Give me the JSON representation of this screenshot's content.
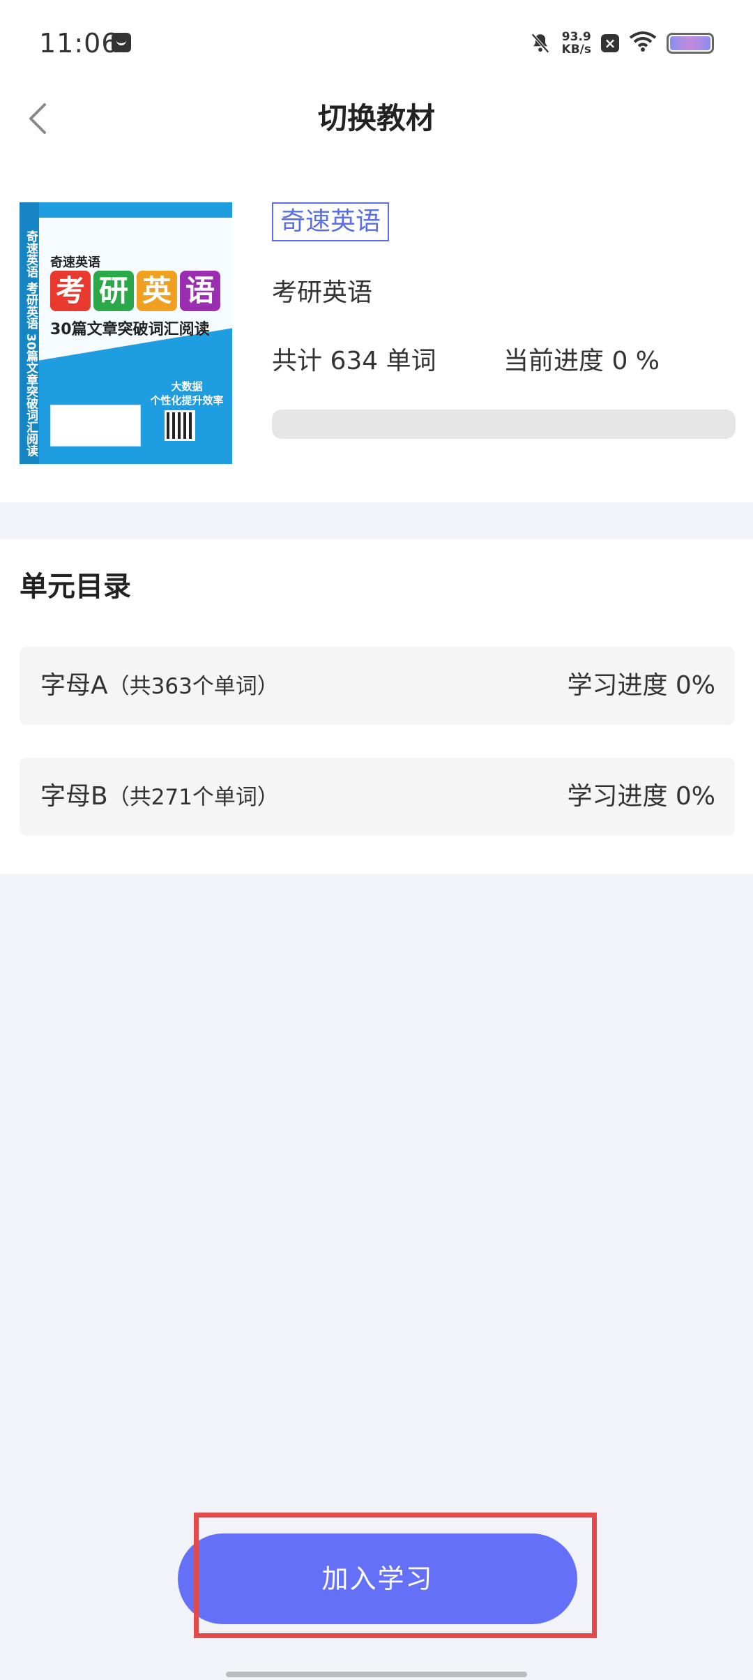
{
  "status_bar": {
    "time": "11:06",
    "net_speed_value": "93.9",
    "net_speed_unit": "KB/s",
    "battery_level": 1.0
  },
  "header": {
    "title": "切换教材"
  },
  "book": {
    "tag": "奇速英语",
    "name": "考研英语",
    "total": "共计 634 单词",
    "progress_text": "当前进度 0 %",
    "progress_value": 0,
    "cover": {
      "brand": "奇速英语",
      "spine": "奇速英语 考研英语 30篇文章突破词汇阅读",
      "tiles": [
        "考",
        "研",
        "英",
        "语"
      ],
      "tile_colors": [
        "#e8392f",
        "#2aa84a",
        "#f0a020",
        "#9a2db0"
      ],
      "subtitle": "30篇文章突破词汇阅读",
      "badge_line1": "大数据",
      "badge_line2": "个性化提升效率"
    }
  },
  "units": {
    "title": "单元目录",
    "items": [
      {
        "name": "字母A",
        "count": "（共363个单词）",
        "progress": "学习进度 0%"
      },
      {
        "name": "字母B",
        "count": "（共271个单词）",
        "progress": "学习进度 0%"
      }
    ]
  },
  "footer": {
    "join_label": "加入学习"
  },
  "colors": {
    "accent": "#6470f7",
    "highlight": "#e24b4b"
  }
}
